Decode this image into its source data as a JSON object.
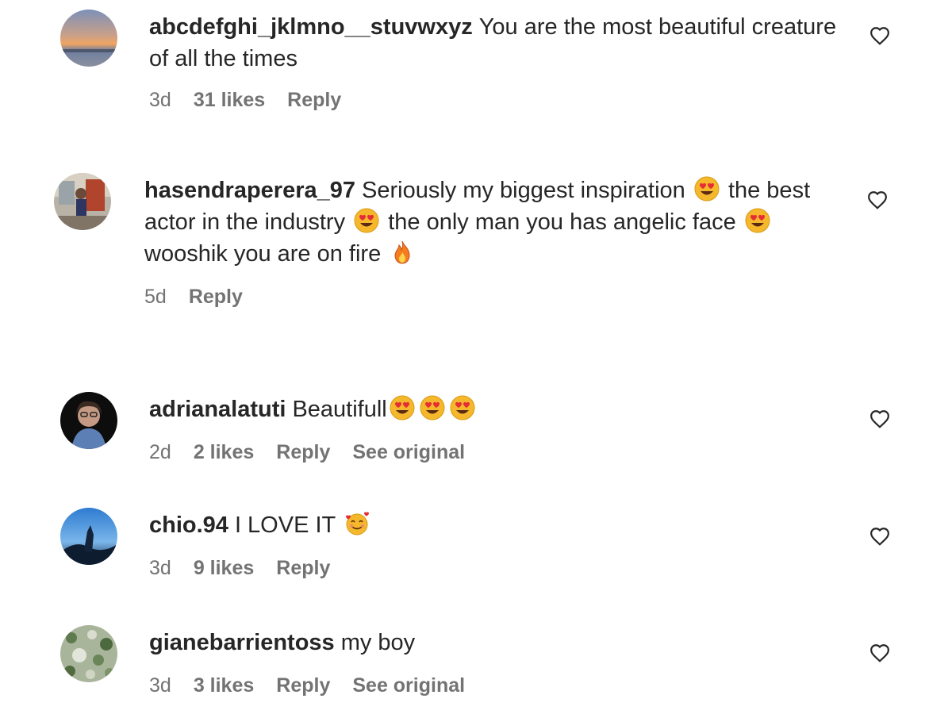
{
  "comments": [
    {
      "username": "abcdefghi_jklmno__stuvwxyz",
      "text": "You are the most beautiful creature of all the times",
      "time": "3d",
      "likes": "31 likes",
      "reply": "Reply"
    },
    {
      "username": "hasendraperera_97",
      "text_parts": [
        "Seriously my biggest inspiration",
        "the best actor in the industry",
        "the only man you has angelic face",
        "wooshik you are on fire"
      ],
      "emojis": [
        "heart-eyes-emoji",
        "heart-eyes-emoji",
        "heart-eyes-emoji",
        "fire-emoji"
      ],
      "time": "5d",
      "reply": "Reply"
    },
    {
      "username": "adrianalatuti",
      "text": "Beautifull",
      "emojis": [
        "heart-eyes-emoji",
        "heart-eyes-emoji",
        "heart-eyes-emoji"
      ],
      "time": "2d",
      "likes": "2 likes",
      "reply": "Reply",
      "see_original": "See original"
    },
    {
      "username": "chio.94",
      "text": "I LOVE IT",
      "emojis": [
        "smiling-hearts-emoji"
      ],
      "time": "3d",
      "likes": "9 likes",
      "reply": "Reply"
    },
    {
      "username": "gianebarrientoss",
      "text": "my boy",
      "time": "3d",
      "likes": "3 likes",
      "reply": "Reply",
      "see_original": "See original"
    }
  ],
  "icons": {
    "like": "heart-outline-icon"
  },
  "colors": {
    "text": "#262626",
    "secondary": "#737373",
    "background": "#ffffff"
  }
}
